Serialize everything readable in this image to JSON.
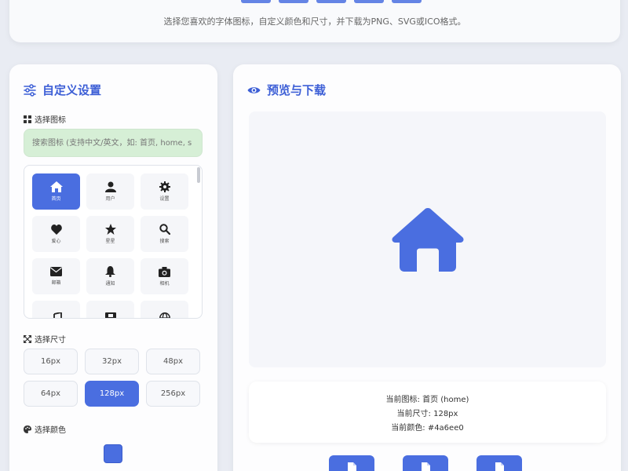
{
  "header": {
    "subtitle": "选择您喜欢的字体图标，自定义颜色和尺寸，并下载为PNG、SVG或ICO格式。"
  },
  "settings": {
    "title": "自定义设置",
    "choose_icon_label": "选择图标",
    "search_placeholder": "搜索图标 (支持中文/英文，如: 首页, home, s",
    "icons": [
      {
        "name": "home-icon",
        "label": "首页",
        "active": true
      },
      {
        "name": "user-icon",
        "label": "用户",
        "active": false
      },
      {
        "name": "gear-icon",
        "label": "设置",
        "active": false
      },
      {
        "name": "heart-icon",
        "label": "爱心",
        "active": false
      },
      {
        "name": "star-icon",
        "label": "星星",
        "active": false
      },
      {
        "name": "search-icon",
        "label": "搜索",
        "active": false
      },
      {
        "name": "envelope-icon",
        "label": "邮箱",
        "active": false
      },
      {
        "name": "bell-icon",
        "label": "通知",
        "active": false
      },
      {
        "name": "camera-icon",
        "label": "相机",
        "active": false
      },
      {
        "name": "music-icon",
        "label": "",
        "active": false
      },
      {
        "name": "film-icon",
        "label": "",
        "active": false
      },
      {
        "name": "globe-icon",
        "label": "",
        "active": false
      }
    ],
    "choose_size_label": "选择尺寸",
    "sizes": [
      "16px",
      "32px",
      "48px",
      "64px",
      "128px",
      "256px"
    ],
    "selected_size": "128px",
    "choose_color_label": "选择颜色",
    "selected_color": "#4a6ee0"
  },
  "preview": {
    "title": "预览与下载",
    "current_icon": "当前图标: 首页 (home)",
    "current_size": "当前尺寸: 128px",
    "current_color": "当前颜色: #4a6ee0",
    "download_buttons": [
      "file-png-icon",
      "file-svg-icon",
      "file-ico-icon"
    ]
  },
  "colors": {
    "accent": "#4a6ee0",
    "search_bg": "#d6efd6"
  }
}
